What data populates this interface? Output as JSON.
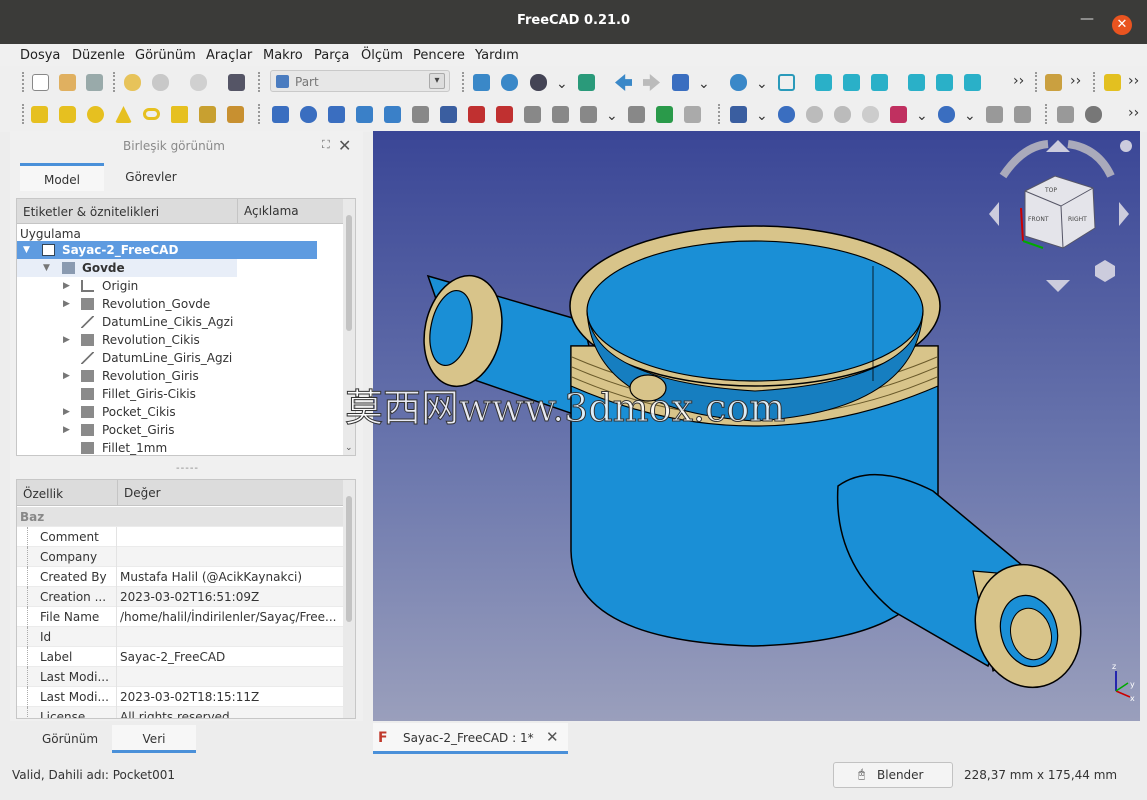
{
  "window": {
    "title": "FreeCAD 0.21.0"
  },
  "menu": [
    "Dosya",
    "Düzenle",
    "Görünüm",
    "Araçlar",
    "Makro",
    "Parça",
    "Ölçüm",
    "Pencere",
    "Yardım"
  ],
  "workbench": {
    "selected": "Part"
  },
  "combo_view": {
    "title": "Birleşik görünüm",
    "tabs": [
      "Model",
      "Görevler"
    ],
    "active_tab": "Model"
  },
  "tree": {
    "columns": [
      "Etiketler & öznitelikleri",
      "Açıklama"
    ],
    "section": "Uygulama",
    "items": [
      {
        "label": "Sayac-2_FreeCAD",
        "level": 0,
        "icon": "document-icon",
        "selected": true
      },
      {
        "label": "Govde",
        "level": 1,
        "icon": "body-icon",
        "bold": true
      },
      {
        "label": "Origin",
        "level": 2,
        "icon": "origin-icon"
      },
      {
        "label": "Revolution_Govde",
        "level": 2,
        "icon": "revolution-icon"
      },
      {
        "label": "DatumLine_Cikis_Agzi",
        "level": 2,
        "icon": "datum-line-icon"
      },
      {
        "label": "Revolution_Cikis",
        "level": 2,
        "icon": "revolution-icon"
      },
      {
        "label": "DatumLine_Giris_Agzi",
        "level": 2,
        "icon": "datum-line-icon"
      },
      {
        "label": "Revolution_Giris",
        "level": 2,
        "icon": "revolution-icon"
      },
      {
        "label": "Fillet_Giris-Cikis",
        "level": 2,
        "icon": "fillet-icon"
      },
      {
        "label": "Pocket_Cikis",
        "level": 2,
        "icon": "pocket-icon"
      },
      {
        "label": "Pocket_Giris",
        "level": 2,
        "icon": "pocket-icon"
      },
      {
        "label": "Fillet_1mm",
        "level": 2,
        "icon": "fillet-icon"
      }
    ]
  },
  "properties": {
    "columns": [
      "Özellik",
      "Değer"
    ],
    "group": "Baz",
    "rows": [
      {
        "key": "Comment",
        "value": ""
      },
      {
        "key": "Company",
        "value": ""
      },
      {
        "key": "Created By",
        "value": "Mustafa Halil (@AcikKaynakci)"
      },
      {
        "key": "Creation ...",
        "value": "2023-03-02T16:51:09Z"
      },
      {
        "key": "File Name",
        "value": "/home/halil/İndirilenler/Sayaç/Free..."
      },
      {
        "key": "Id",
        "value": ""
      },
      {
        "key": "Label",
        "value": "Sayac-2_FreeCAD"
      },
      {
        "key": "Last Modi...",
        "value": ""
      },
      {
        "key": "Last Modi...",
        "value": "2023-03-02T18:15:11Z"
      },
      {
        "key": "License",
        "value": "All rights reserved"
      }
    ]
  },
  "bottom_tabs": [
    "Görünüm",
    "Veri"
  ],
  "active_bottom_tab": "Veri",
  "document_tab": {
    "label": "Sayac-2_FreeCAD : 1*"
  },
  "status": {
    "message": "Valid, Dahili adı: Pocket001",
    "nav_style": "Blender",
    "dimensions": "228,37 mm x 175,44 mm"
  },
  "watermark": "莫西网www.3dmox.com",
  "navcube": {
    "faces": [
      "TOP",
      "FRONT",
      "RIGHT"
    ]
  },
  "colors": {
    "accent": "#4a90d9",
    "selection": "#5e9be0",
    "model_blue": "#1a8fd6",
    "thread_gold": "#d8c48a",
    "close": "#e95420"
  }
}
